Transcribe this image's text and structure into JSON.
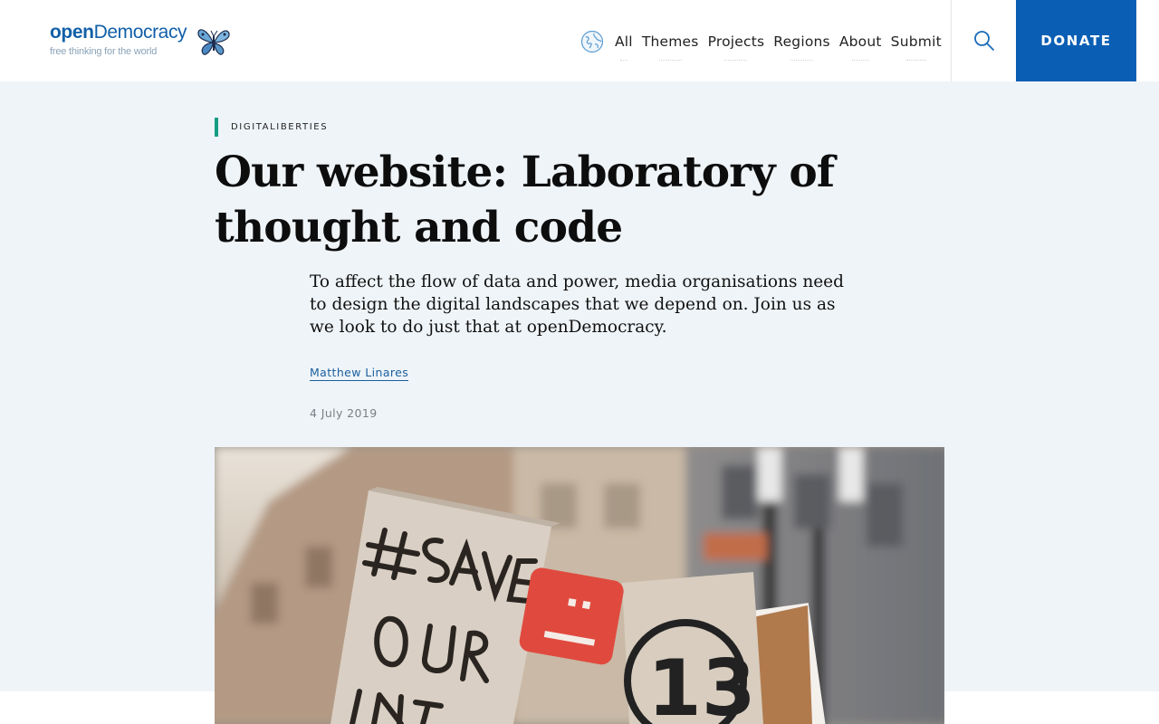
{
  "header": {
    "logo": {
      "brand_open": "open",
      "brand_rest": "Democracy",
      "tagline": "free thinking for the world",
      "icon": "butterfly-icon"
    },
    "nav": {
      "icon": "globe-icon",
      "items": [
        {
          "label": "All"
        },
        {
          "label": "Themes"
        },
        {
          "label": "Projects"
        },
        {
          "label": "Regions"
        },
        {
          "label": "About"
        },
        {
          "label": "Submit"
        }
      ]
    },
    "search": {
      "icon": "search-icon"
    },
    "donate_label": "DONATE"
  },
  "article": {
    "category": "DIGITALIBERTIES",
    "title": "Our website: Laboratory of thought and code",
    "standfirst": "To affect the flow of data and power, media organisations need to design the digital landscapes that we depend on. Join us as we look to do just that at openDemocracy.",
    "author": "Matthew Linares",
    "date": "4 July 2019"
  },
  "colors": {
    "brand_blue": "#0a5fb4",
    "link_blue": "#1a5f9e",
    "category_accent": "#149e84",
    "hero_background": "#eff4f8"
  }
}
